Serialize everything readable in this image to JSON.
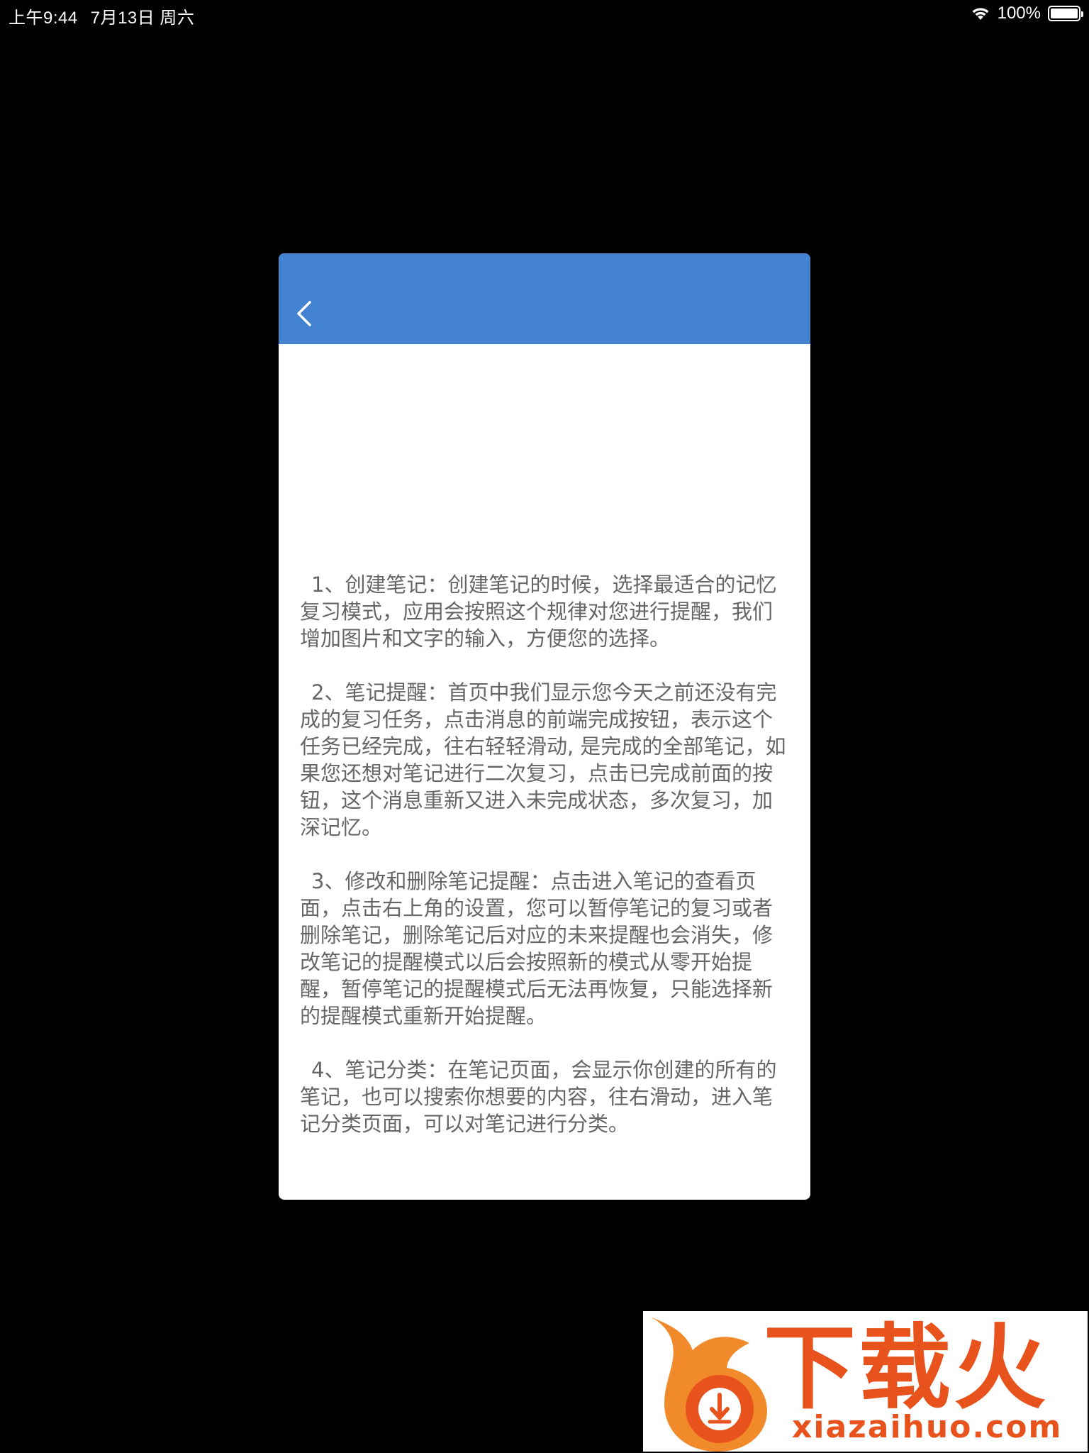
{
  "status_bar": {
    "time": "上午9:44",
    "date": "7月13日 周六",
    "battery": "100%"
  },
  "header": {
    "back_icon": "chevron-left-icon",
    "color": "#4382d0"
  },
  "help": {
    "paragraphs": [
      "1、创建笔记：创建笔记的时候，选择最适合的记忆复习模式，应用会按照这个规律对您进行提醒，我们增加图片和文字的输入，方便您的选择。",
      "2、笔记提醒：首页中我们显示您今天之前还没有完成的复习任务，点击消息的前端完成按钮，表示这个任务已经完成，往右轻轻滑动, 是完成的全部笔记，如果您还想对笔记进行二次复习，点击已完成前面的按钮，这个消息重新又进入未完成状态，多次复习，加深记忆。",
      "3、修改和删除笔记提醒：点击进入笔记的查看页面，点击右上角的设置，您可以暂停笔记的复习或者删除笔记，删除笔记后对应的未来提醒也会消失，修改笔记的提醒模式以后会按照新的模式从零开始提醒，暂停笔记的提醒模式后无法再恢复，只能选择新的提醒模式重新开始提醒。",
      "4、笔记分类：在笔记页面，会显示你创建的所有的笔记，也可以搜索你想要的内容，往右滑动，进入笔记分类页面，可以对笔记进行分类。"
    ]
  },
  "watermark": {
    "brand": "下载火",
    "domain": "xiazaihuo.com",
    "color": "#e8521c"
  }
}
